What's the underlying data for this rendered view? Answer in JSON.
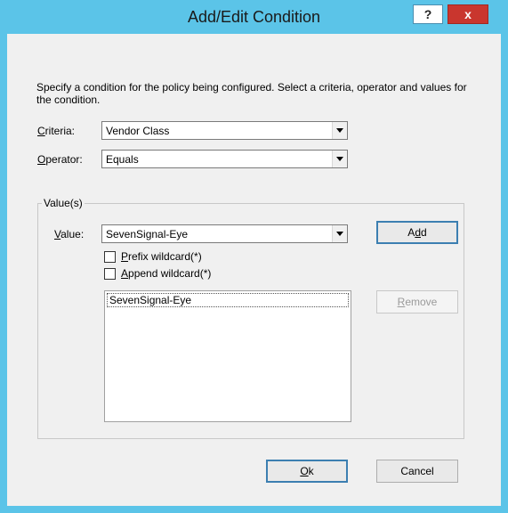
{
  "window": {
    "title": "Add/Edit Condition",
    "help_label": "?",
    "close_label": "x"
  },
  "description": "Specify a condition for the policy being configured. Select a criteria, operator and values for the condition.",
  "criteria": {
    "label_mnemonic": "C",
    "label_rest": "riteria:",
    "value": "Vendor Class"
  },
  "operator": {
    "label_mnemonic": "O",
    "label_rest": "perator:",
    "value": "Equals"
  },
  "values_group": {
    "title": "Value(s)",
    "value_label_mnemonic": "V",
    "value_label_rest": "alue:",
    "value": "SevenSignal-Eye",
    "add_button_pre": "A",
    "add_button_mnemonic": "d",
    "add_button_post": "d",
    "prefix_mnemonic": "P",
    "prefix_rest": "refix wildcard(*)",
    "append_mnemonic": "A",
    "append_rest": "ppend wildcard(*)",
    "list_items": [
      "SevenSignal-Eye"
    ],
    "remove_mnemonic": "R",
    "remove_rest": "emove"
  },
  "ok_mnemonic": "O",
  "ok_rest": "k",
  "cancel_label": "Cancel"
}
